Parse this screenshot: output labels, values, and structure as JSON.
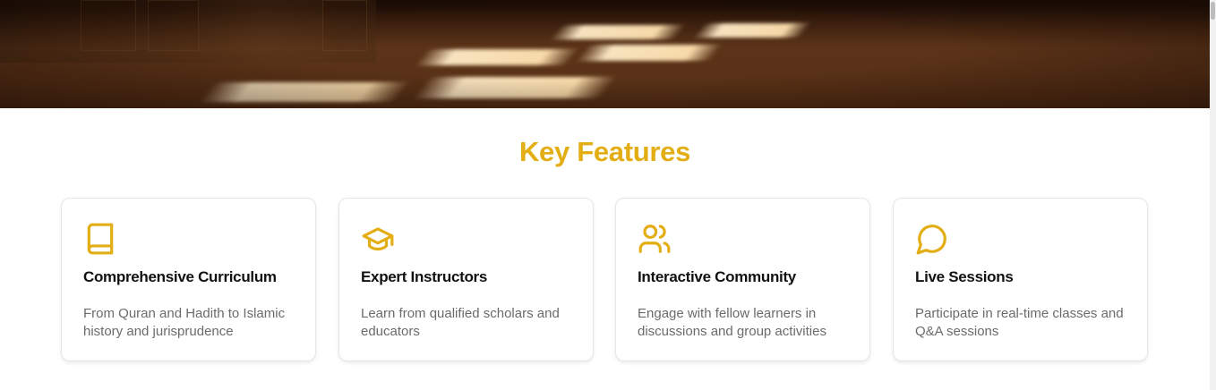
{
  "hero": {
    "image_alt": "Sunlit wooden floor inside a mosque"
  },
  "features": {
    "title": "Key Features",
    "accent_color": "#e3ad14",
    "cards": [
      {
        "icon": "book-icon",
        "title": "Comprehensive Curriculum",
        "description": "From Quran and Hadith to Islamic history and jurisprudence"
      },
      {
        "icon": "graduation-cap-icon",
        "title": "Expert Instructors",
        "description": "Learn from qualified scholars and educators"
      },
      {
        "icon": "users-icon",
        "title": "Interactive Community",
        "description": "Engage with fellow learners in discussions and group activities"
      },
      {
        "icon": "message-circle-icon",
        "title": "Live Sessions",
        "description": "Participate in real-time classes and Q&A sessions"
      }
    ]
  }
}
